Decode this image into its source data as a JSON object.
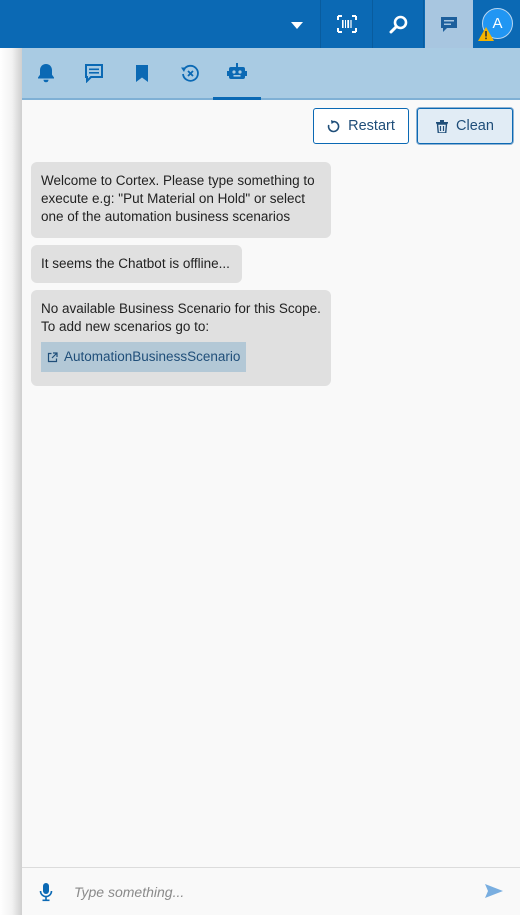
{
  "header": {
    "avatar_letter": "A",
    "icons": [
      "chevron-down-icon",
      "barcode-icon",
      "search-icon",
      "chat-icon",
      "avatar",
      "warning-icon"
    ],
    "accent": "#0b69b4"
  },
  "tabs": [
    {
      "name": "notifications",
      "icon": "bell-icon"
    },
    {
      "name": "messages",
      "icon": "message-icon"
    },
    {
      "name": "bookmarks",
      "icon": "bookmark-icon"
    },
    {
      "name": "cancel-history",
      "icon": "history-cancel-icon"
    },
    {
      "name": "chatbot",
      "icon": "robot-icon",
      "active": true
    }
  ],
  "actions": {
    "restart_label": "Restart",
    "clean_label": "Clean"
  },
  "messages": [
    {
      "text": "Welcome to Cortex. Please type something to execute e.g: \"Put Material on Hold\" or select one of the automation business scenarios"
    },
    {
      "text": "It seems the Chatbot is offline..."
    },
    {
      "text": "No available Business Scenario for this Scope. To add new scenarios go to:",
      "link": "AutomationBusinessScenario"
    }
  ],
  "input": {
    "placeholder": "Type something...",
    "value": ""
  }
}
